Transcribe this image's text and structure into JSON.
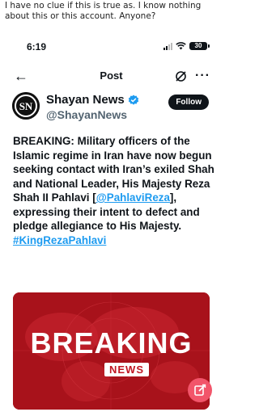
{
  "caption": "I have no clue if this is true as. I know nothing about this or this account. Anyone?",
  "statusbar": {
    "time": "6:19",
    "battery": "30"
  },
  "nav": {
    "title": "Post"
  },
  "profile": {
    "name": "Shayan News",
    "handle": "@ShayanNews",
    "follow_label": "Follow",
    "avatar_text": "SN"
  },
  "tweet": {
    "text_before": "BREAKING: Military officers of the Islamic regime in Iran have now begun seeking contact with Iran’s exiled Shah and National Leader, His Majesty Reza Shah II Pahlavi [",
    "mention": "@PahlaviReza",
    "text_after": "], expressing their intent to defect and pledge allegiance to His Majesty.",
    "hashtag": "#KingRezaPahlavi"
  },
  "media": {
    "headline": "BREAKING",
    "label": "NEWS"
  },
  "colors": {
    "link": "#1d9bf0",
    "accent": "#f2556a",
    "breaking_red": "#b0121a"
  }
}
